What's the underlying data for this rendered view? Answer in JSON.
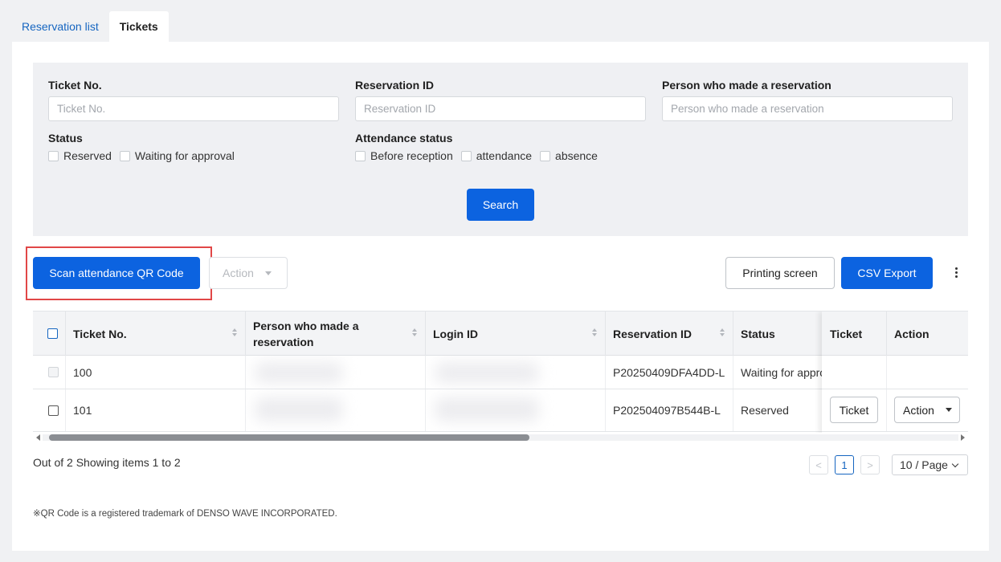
{
  "tabs": [
    {
      "label": "Reservation list",
      "active": false
    },
    {
      "label": "Tickets",
      "active": true
    }
  ],
  "filters": {
    "ticket_no": {
      "label": "Ticket No.",
      "placeholder": "Ticket No.",
      "value": ""
    },
    "reservation_id": {
      "label": "Reservation ID",
      "placeholder": "Reservation ID",
      "value": ""
    },
    "person": {
      "label": "Person who made a reservation",
      "placeholder": "Person who made a reservation",
      "value": ""
    },
    "status": {
      "label": "Status",
      "options": [
        "Reserved",
        "Waiting for approval"
      ]
    },
    "attendance": {
      "label": "Attendance status",
      "options": [
        "Before reception",
        "attendance",
        "absence"
      ]
    },
    "search_label": "Search"
  },
  "toolbar": {
    "scan_label": "Scan attendance QR Code",
    "action_label": "Action",
    "printing_label": "Printing screen",
    "csv_label": "CSV Export"
  },
  "table": {
    "columns": [
      "Ticket No.",
      "Person who made a reservation",
      "Login ID",
      "Reservation ID",
      "Status",
      "Ticket",
      "Action"
    ],
    "rows": [
      {
        "ticket_no": "100",
        "reservation_id": "P20250409DFA4DD-L",
        "status": "Waiting for approval",
        "ticket_button": "",
        "action_button": ""
      },
      {
        "ticket_no": "101",
        "reservation_id": "P202504097B544B-L",
        "status": "Reserved",
        "ticket_button": "Ticket",
        "action_button": "Action"
      }
    ]
  },
  "pagination": {
    "summary": "Out of 2 Showing items 1 to 2",
    "prev": "<",
    "current_page": "1",
    "next": ">",
    "page_size": "10 / Page"
  },
  "footnote": "※QR Code is a registered trademark of DENSO WAVE INCORPORATED.",
  "colors": {
    "primary": "#0c63e0",
    "highlight": "#e14747",
    "link": "#1565c0"
  }
}
